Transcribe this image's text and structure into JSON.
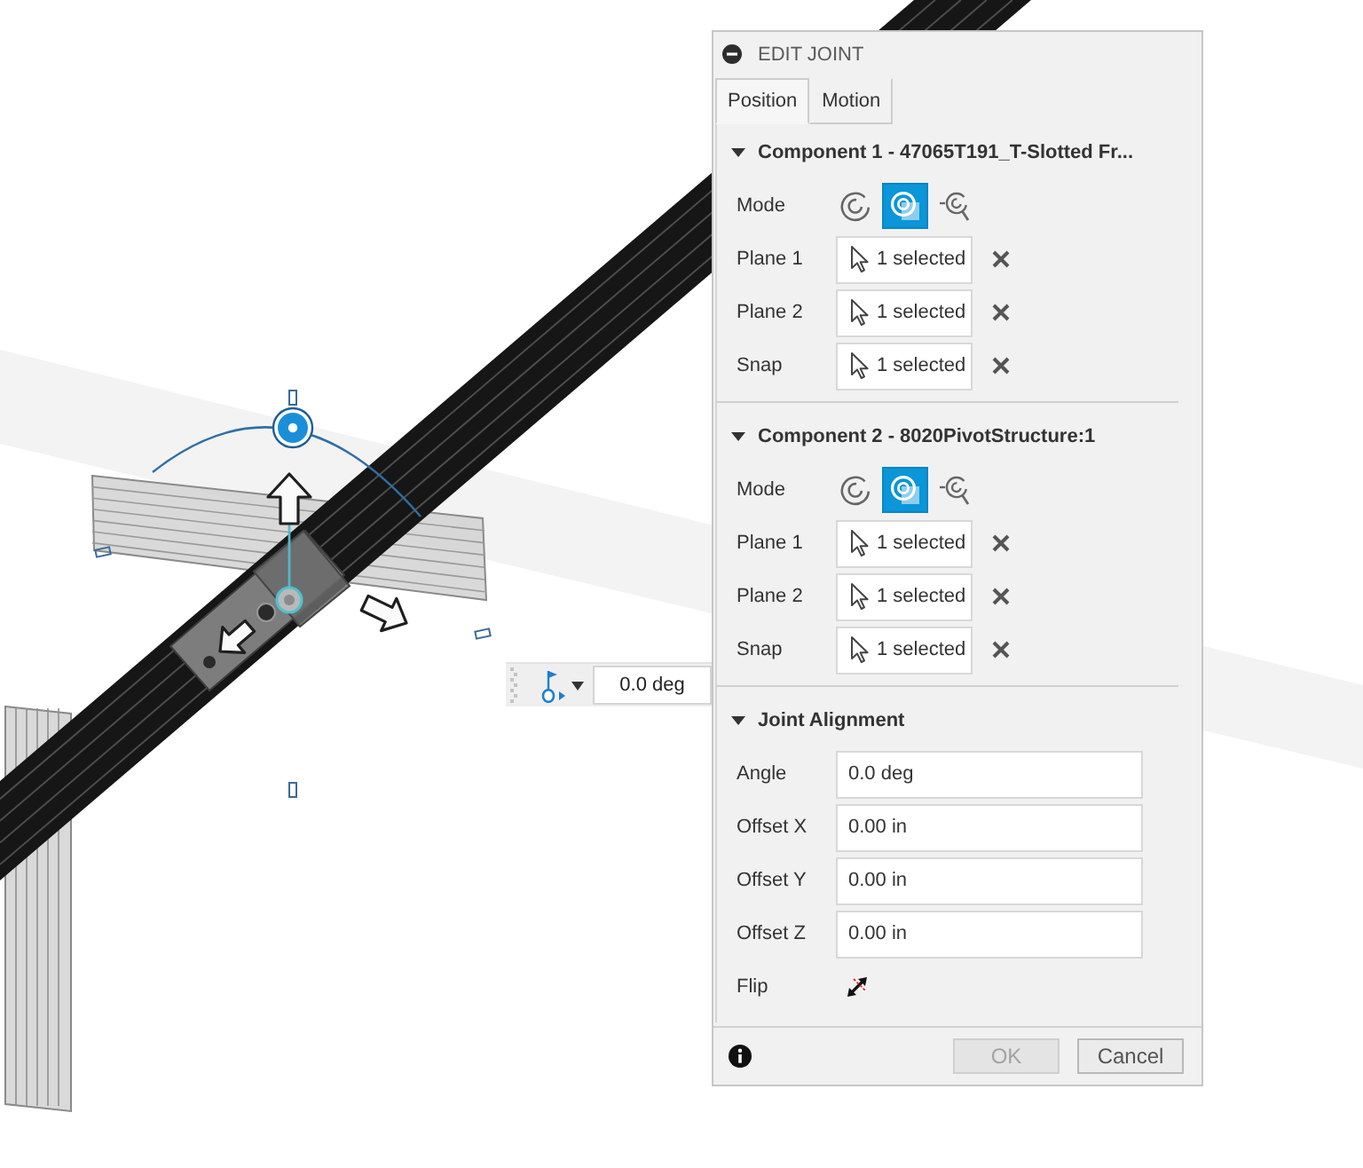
{
  "viewport": {
    "angle_input": {
      "value": "0.0 deg"
    }
  },
  "dialog": {
    "title": "EDIT JOINT",
    "tabs": [
      {
        "label": "Position",
        "selected": true
      },
      {
        "label": "Motion",
        "selected": false
      }
    ],
    "components": [
      {
        "title": "Component 1 - 47065T191_T-Slotted Fr...",
        "expanded": true,
        "mode_label": "Mode",
        "modes": [
          {
            "kind": "ring",
            "selected": false
          },
          {
            "kind": "center",
            "selected": true
          },
          {
            "kind": "offset",
            "selected": false
          }
        ],
        "selections": [
          {
            "label": "Plane 1",
            "value": "1 selected"
          },
          {
            "label": "Plane 2",
            "value": "1 selected"
          },
          {
            "label": "Snap",
            "value": "1 selected"
          }
        ]
      },
      {
        "title": "Component 2 - 8020PivotStructure:1",
        "expanded": true,
        "mode_label": "Mode",
        "modes": [
          {
            "kind": "ring",
            "selected": false
          },
          {
            "kind": "center",
            "selected": true
          },
          {
            "kind": "offset",
            "selected": false
          }
        ],
        "selections": [
          {
            "label": "Plane 1",
            "value": "1 selected"
          },
          {
            "label": "Plane 2",
            "value": "1 selected"
          },
          {
            "label": "Snap",
            "value": "1 selected"
          }
        ]
      }
    ],
    "alignment": {
      "title": "Joint Alignment",
      "expanded": true,
      "fields": [
        {
          "label": "Angle",
          "value": "0.0 deg"
        },
        {
          "label": "Offset X",
          "value": "0.00 in"
        },
        {
          "label": "Offset Y",
          "value": "0.00 in"
        },
        {
          "label": "Offset Z",
          "value": "0.00 in"
        }
      ],
      "flip_label": "Flip"
    },
    "buttons": [
      {
        "label": "OK",
        "disabled": true
      },
      {
        "label": "Cancel",
        "disabled": false
      }
    ]
  }
}
